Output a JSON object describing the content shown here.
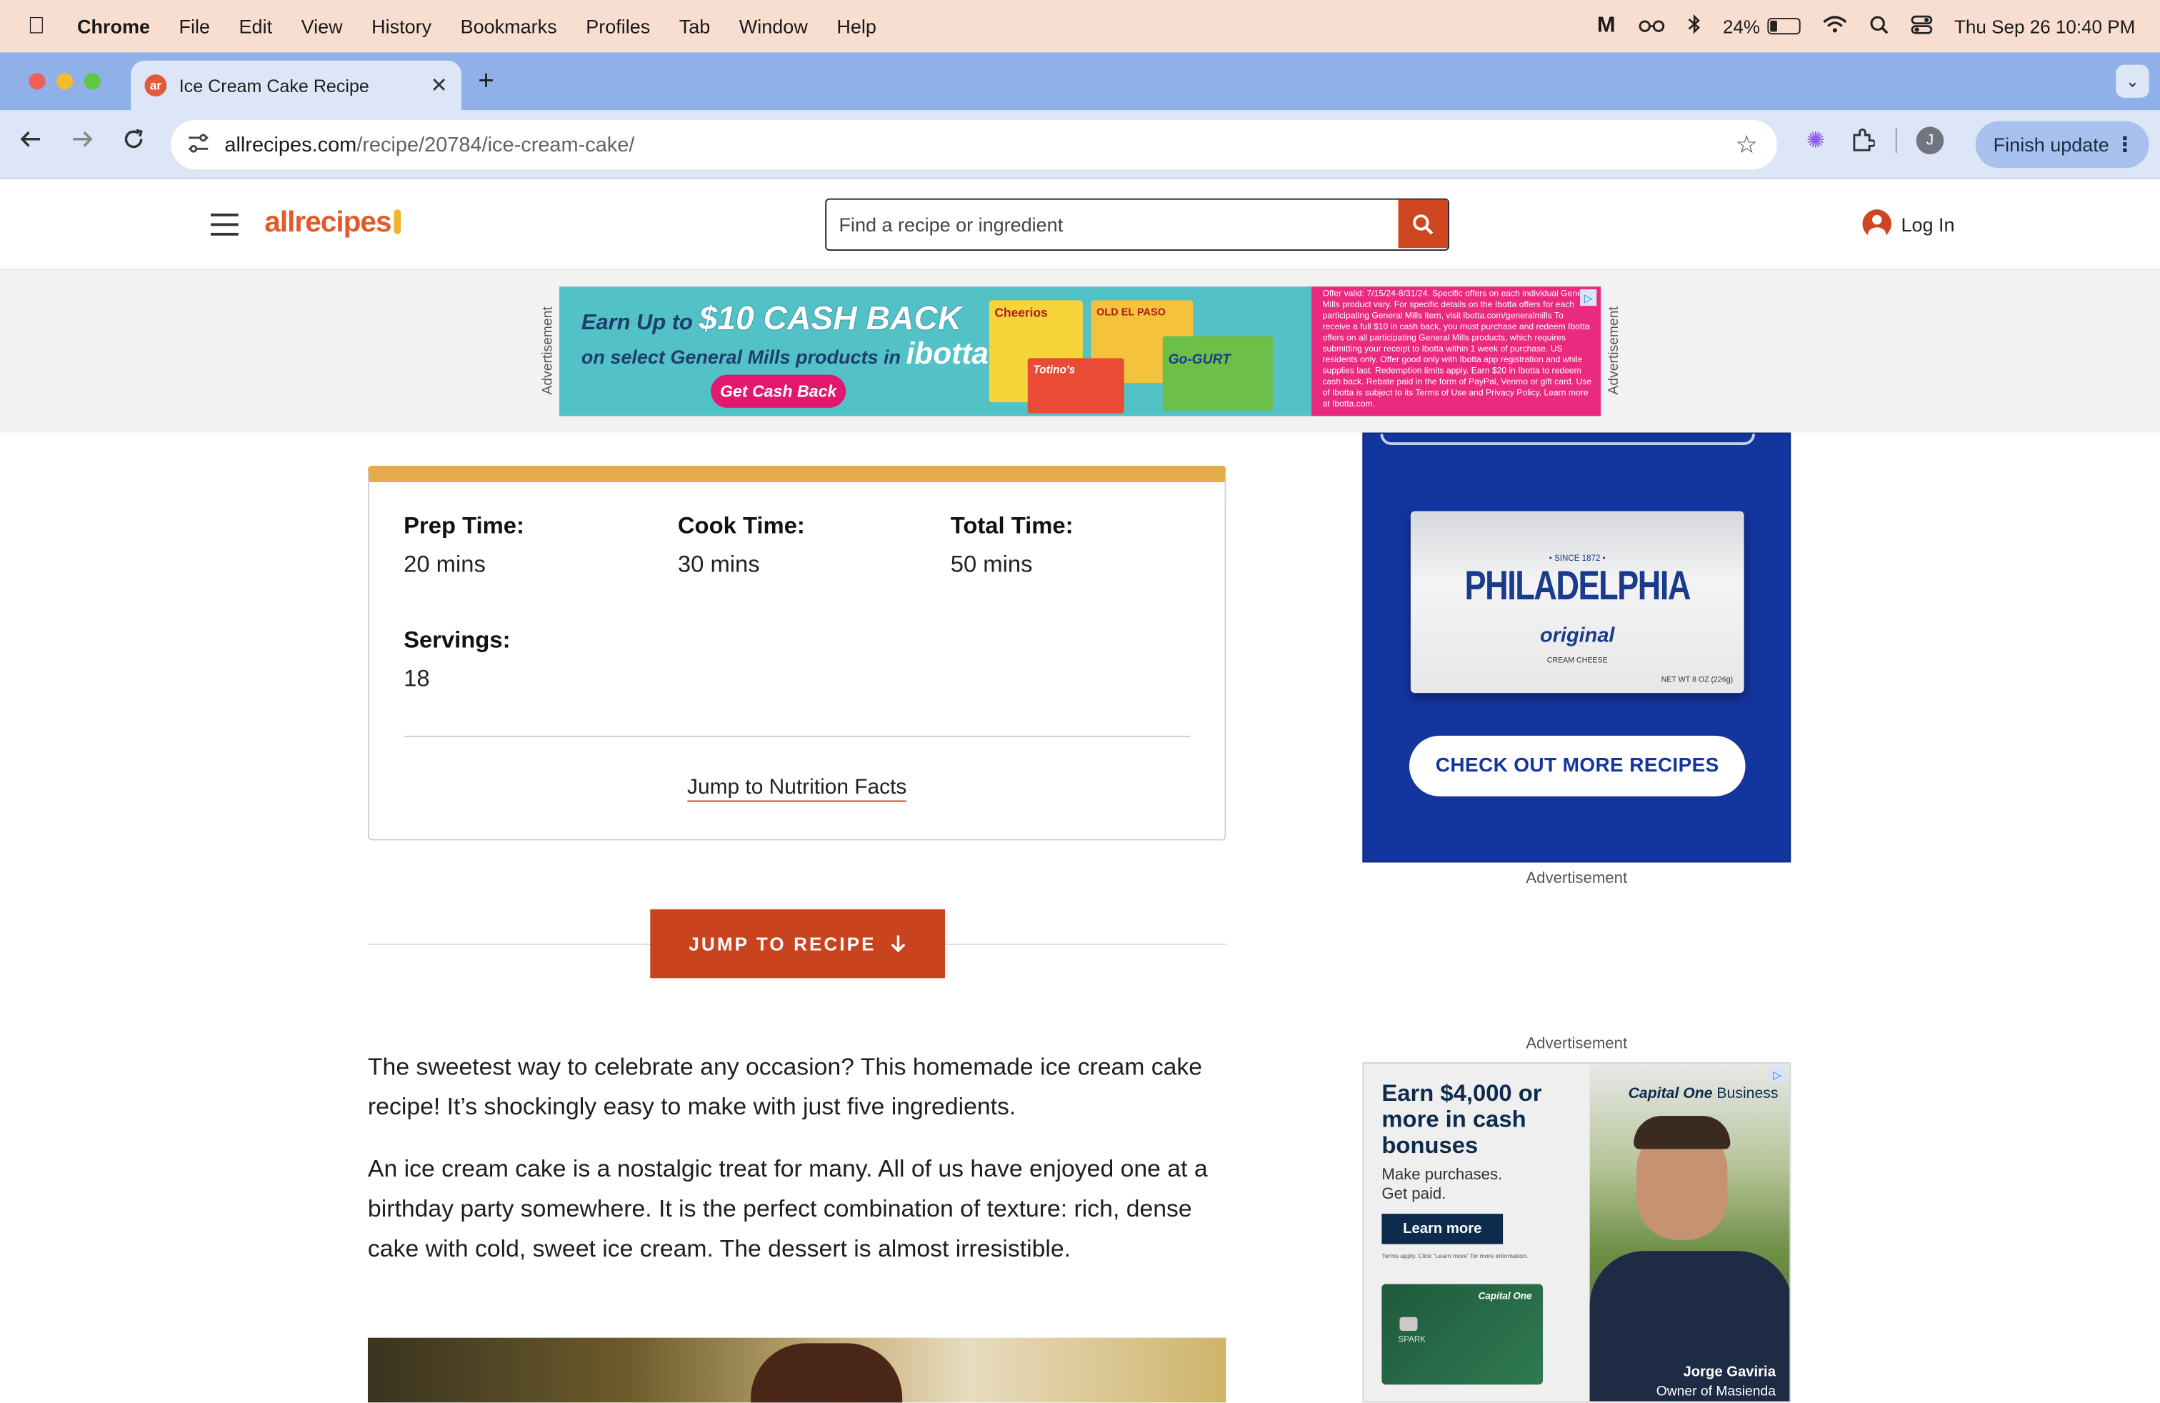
{
  "menubar": {
    "app": "Chrome",
    "items": [
      "File",
      "Edit",
      "View",
      "History",
      "Bookmarks",
      "Profiles",
      "Tab",
      "Window",
      "Help"
    ],
    "battery": "24%",
    "datetime": "Thu Sep 26  10:40 PM"
  },
  "browser": {
    "tab_title": "Ice Cream Cake Recipe",
    "tab_favicon": "ar",
    "url_host": "allrecipes.com",
    "url_path": "/recipe/20784/ice-cream-cake/",
    "profile_initial": "J",
    "finish_update": "Finish update"
  },
  "site": {
    "logo": "allrecipes",
    "search_placeholder": "Find a recipe or ingredient",
    "login": "Log In"
  },
  "top_ad": {
    "label": "Advertisement",
    "line1_prefix": "Earn Up to",
    "line1_amount": "$10 CASH BACK",
    "line2_prefix": "on select General Mills products in",
    "line2_brand": "ibotta",
    "cta": "Get Cash Back",
    "products": [
      "Cheerios",
      "OLD EL PASO",
      "Totino's",
      "Go-GURT"
    ],
    "fine_print": "Offer valid: 7/15/24-8/31/24. Specific offers on each individual General Mills product vary. For specific details on the Ibotta offers for each participating General Mills item, visit ibotta.com/generalmills To receive a full $10 in cash back, you must purchase and redeem Ibotta offers on all participating General Mills products, which requires submitting your receipt to Ibotta within 1 week of purchase. US residents only. Offer good only with Ibotta app registration and while supplies last. Redemption limits apply. Earn $20 in Ibotta to redeem cash back. Rebate paid in the form of PayPal, Venmo or gift card. Use of Ibotta is subject to its Terms of Use and Privacy Policy. Learn more at Ibotta.com."
  },
  "recipe": {
    "stats": [
      {
        "label": "Prep Time:",
        "value": "20 mins"
      },
      {
        "label": "Cook Time:",
        "value": "30 mins"
      },
      {
        "label": "Total Time:",
        "value": "50 mins"
      },
      {
        "label": "Servings:",
        "value": "18"
      }
    ],
    "nutrition_link": "Jump to Nutrition Facts",
    "jump_button": "JUMP TO RECIPE",
    "paragraphs": [
      "The sweetest way to celebrate any occasion? This homemade ice cream cake recipe! It’s shockingly easy to make with just five ingredients.",
      "An ice cream cake is a nostalgic treat for many. All of us have enjoyed one at a birthday party somewhere. It is the perfect combination of texture: rich, dense cake with cold, sweet ice cream. The dessert is almost irresistible."
    ]
  },
  "rail": {
    "philly_ad": {
      "brand": "PHILADELPHIA",
      "since": "• SINCE 1872 •",
      "variant": "original",
      "product": "CREAM CHEESE",
      "weight": "NET WT 8 OZ (226g)",
      "cta": "CHECK OUT MORE RECIPES",
      "label": "Advertisement"
    },
    "capone_ad": {
      "label": "Advertisement",
      "headline": "Earn $4,000 or more in cash bonuses",
      "sub": "Make purchases. Get paid.",
      "cta": "Learn more",
      "terms": "Terms apply. Click “Learn more” for more information.",
      "brand": "Capital One",
      "brand_suffix": "Business",
      "card_text": "SPARK",
      "person_name": "Jorge Gaviria",
      "person_title": "Owner of Masienda"
    }
  },
  "colors": {
    "menubar_bg": "#f8ded0",
    "tabstrip_bg": "#8fb0e8",
    "brand_orange": "#ce4620",
    "card_accent": "#e4ac48",
    "philly_blue": "#13359e"
  }
}
